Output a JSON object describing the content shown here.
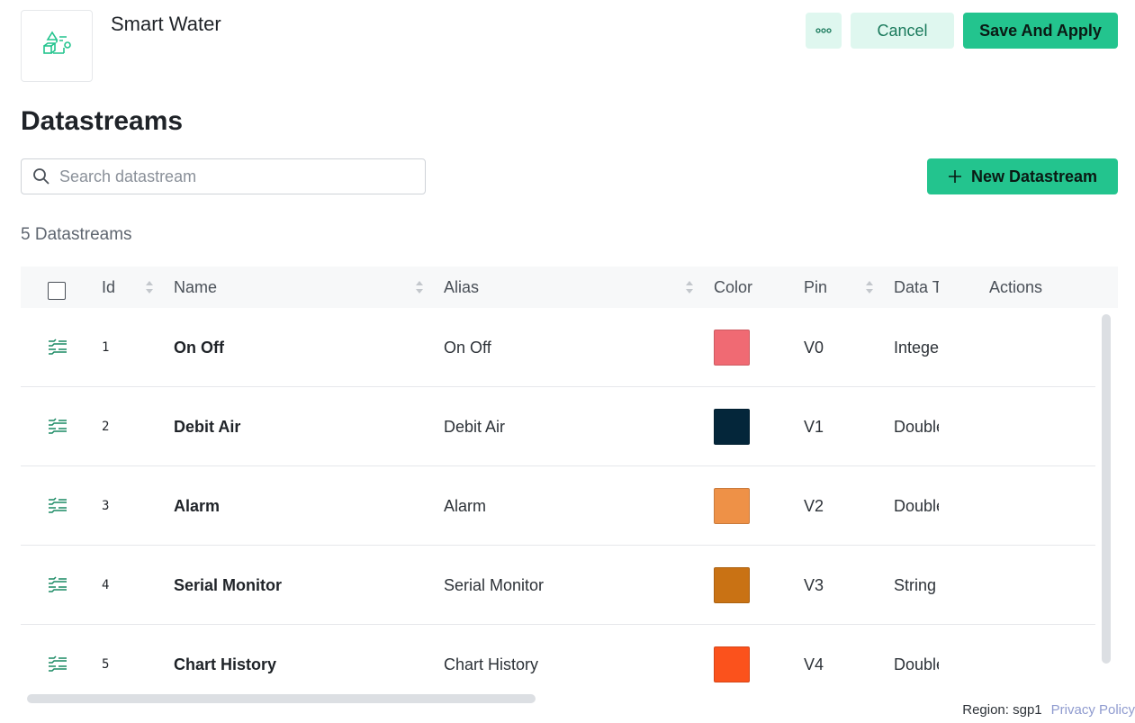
{
  "device": {
    "name": "Smart Water",
    "icon": "device-template-icon"
  },
  "header_actions": {
    "more_label": "···",
    "cancel_label": "Cancel",
    "save_label": "Save And Apply"
  },
  "page": {
    "title": "Datastreams"
  },
  "search": {
    "placeholder": "Search datastream",
    "value": ""
  },
  "new_button": {
    "label": "New Datastream"
  },
  "summary": {
    "count_text": "5 Datastreams"
  },
  "table": {
    "columns": {
      "id": "Id",
      "name": "Name",
      "alias": "Alias",
      "color": "Color",
      "pin": "Pin",
      "data_type": "Data T",
      "actions": "Actions"
    },
    "rows": [
      {
        "id": "1",
        "name": "On Off",
        "alias": "On Off",
        "color": "#f06a73",
        "pin": "V0",
        "data_type": "Intege"
      },
      {
        "id": "2",
        "name": "Debit Air",
        "alias": "Debit Air",
        "color": "#04263a",
        "pin": "V1",
        "data_type": "Double"
      },
      {
        "id": "3",
        "name": "Alarm",
        "alias": "Alarm",
        "color": "#ee9147",
        "pin": "V2",
        "data_type": "Double"
      },
      {
        "id": "4",
        "name": "Serial Monitor",
        "alias": "Serial Monitor",
        "color": "#c97214",
        "pin": "V3",
        "data_type": "String"
      },
      {
        "id": "5",
        "name": "Chart History",
        "alias": "Chart History",
        "color": "#fb521c",
        "pin": "V4",
        "data_type": "Double"
      }
    ]
  },
  "footer": {
    "region": "Region: sgp1",
    "privacy": "Privacy Policy"
  },
  "colors": {
    "accent": "#23c48e",
    "accent_light": "#dff7ef",
    "icon_green": "#1a8a64"
  }
}
